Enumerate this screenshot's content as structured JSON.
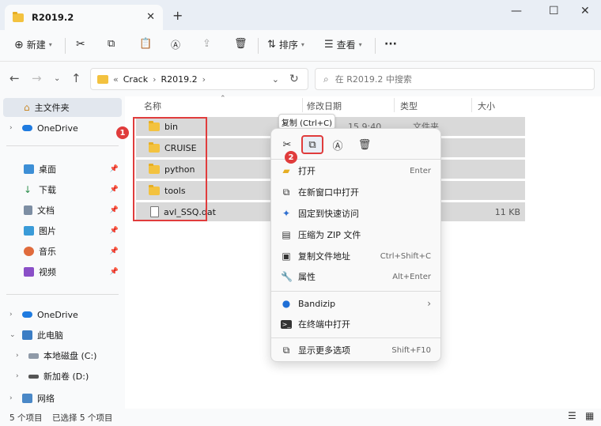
{
  "window": {
    "tab_title": "R2019.2",
    "new_tab": "+",
    "close_tab": "✕",
    "minimize": "—",
    "maximize": "☐",
    "close": "✕"
  },
  "toolbar": {
    "new_label": "新建",
    "sort_label": "排序",
    "view_label": "查看",
    "more": "···"
  },
  "address": {
    "sep": "«",
    "path1": "Crack",
    "chev1": "›",
    "path2": "R2019.2",
    "chev2": "›",
    "search_placeholder": "在 R2019.2 中搜索"
  },
  "sidebar": {
    "home": "主文件夹",
    "onedrive1": "OneDrive",
    "pinned": [
      "桌面",
      "下载",
      "文档",
      "图片",
      "音乐",
      "视频"
    ],
    "onedrive2": "OneDrive",
    "this_pc": "此电脑",
    "drive_c": "本地磁盘 (C:)",
    "drive_d": "新加卷 (D:)",
    "network": "网络"
  },
  "columns": {
    "name": "名称",
    "modified": "修改日期",
    "type": "类型",
    "size": "大小"
  },
  "files": [
    {
      "name": "bin",
      "kind": "folder",
      "size": ""
    },
    {
      "name": "CRUISE",
      "kind": "folder",
      "size": ""
    },
    {
      "name": "python",
      "kind": "folder",
      "size": ""
    },
    {
      "name": "tools",
      "kind": "folder",
      "size": ""
    },
    {
      "name": "avl_SSQ.dat",
      "kind": "file",
      "size": "11 KB"
    }
  ],
  "peek": {
    "date": "15 9:40",
    "type": "文件夹"
  },
  "badges": {
    "one": "1",
    "two": "2"
  },
  "tooltip": "复制 (Ctrl+C)",
  "menu": {
    "items": [
      {
        "label": "打开",
        "key": "Enter"
      },
      {
        "label": "在新窗口中打开",
        "key": ""
      },
      {
        "label": "固定到快速访问",
        "key": ""
      },
      {
        "label": "压缩为 ZIP 文件",
        "key": ""
      },
      {
        "label": "复制文件地址",
        "key": "Ctrl+Shift+C"
      },
      {
        "label": "属性",
        "key": "Alt+Enter"
      }
    ],
    "bandizip": "Bandizip",
    "terminal": "在终端中打开",
    "more": "显示更多选项",
    "more_key": "Shift+F10"
  },
  "status": {
    "count": "5 个项目",
    "selected": "已选择 5 个项目"
  },
  "colors": {
    "accent": "#e03c3c",
    "folder": "#f3c23f",
    "selection": "#d9d9d9"
  }
}
